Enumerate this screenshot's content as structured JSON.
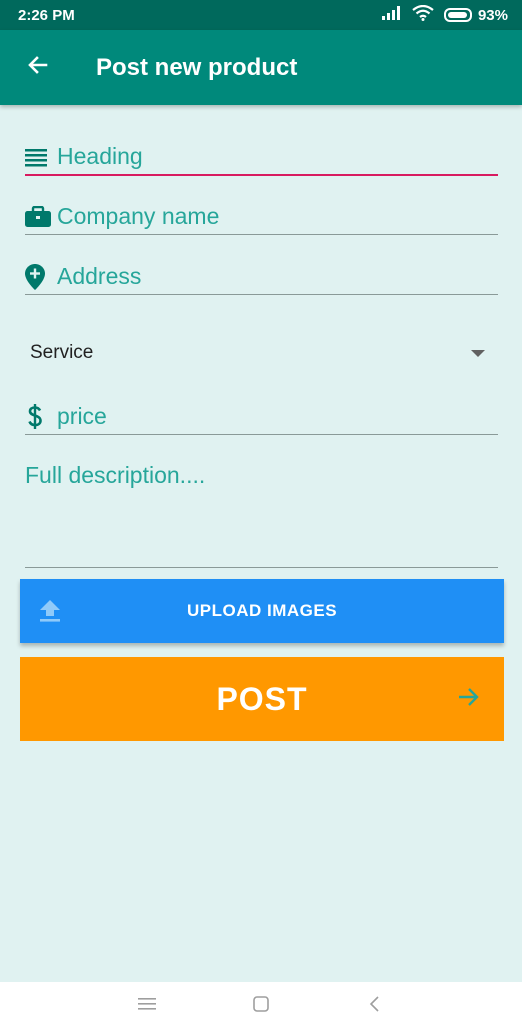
{
  "status_bar": {
    "time": "2:26 PM",
    "battery_text": "93%",
    "battery_level": 0.93,
    "icons": [
      "signal-icon",
      "wifi-icon",
      "battery-icon"
    ]
  },
  "app_bar": {
    "title": "Post new product",
    "back_icon": "arrow-back-icon"
  },
  "form": {
    "heading_placeholder": "Heading",
    "company_placeholder": "Company name",
    "address_placeholder": "Address",
    "service_value": "Service",
    "price_placeholder": "price",
    "description_placeholder": "Full description...."
  },
  "buttons": {
    "upload_label": "UPLOAD IMAGES",
    "post_label": "POST"
  },
  "nav_bar": {
    "icons": [
      "menu-icon",
      "home-square-icon",
      "back-chevron-icon"
    ]
  },
  "colors": {
    "status_bar": "#00695c",
    "app_bar": "#00897b",
    "background": "#e0f2f1",
    "accent_text": "#26a69a",
    "active_underline": "#d81b60",
    "upload_button": "#1f8ff5",
    "post_button": "#ff9800"
  }
}
